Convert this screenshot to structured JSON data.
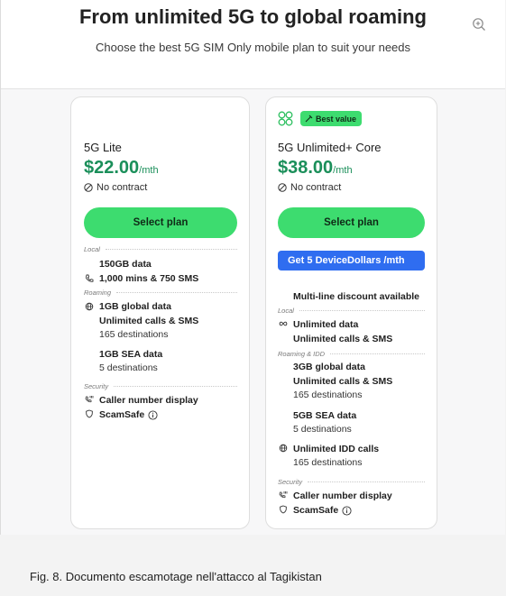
{
  "header": {
    "title": "From unlimited 5G to global roaming",
    "subtitle": "Choose the best 5G SIM Only mobile plan to suit your needs"
  },
  "colors": {
    "accent_green": "#3ddc6f",
    "price_green": "#1b8f5a",
    "promo_blue": "#2f6df0"
  },
  "icons": [
    "zoom-in-icon",
    "no-contract-icon",
    "phone-icon",
    "globe-icon",
    "caller-id-icon",
    "shield-icon",
    "info-icon",
    "infinity-icon",
    "5g-logo-icon",
    "sparkle-icon"
  ],
  "plans": [
    {
      "name": "5G Lite",
      "price": "$22.00",
      "period": "/mth",
      "contract": "No contract",
      "cta": "Select plan",
      "sections": [
        {
          "label": "Local",
          "items": [
            "150GB data",
            "1,000 mins & 750 SMS"
          ]
        },
        {
          "label": "Roaming",
          "items": [
            "1GB global data",
            "Unlimited calls & SMS",
            "165 destinations",
            "1GB SEA data",
            "5 destinations"
          ]
        },
        {
          "label": "Security",
          "items": [
            "Caller number display",
            "ScamSafe"
          ]
        }
      ]
    },
    {
      "name": "5G Unlimited+ Core",
      "badge": "Best value",
      "price": "$38.00",
      "period": "/mth",
      "contract": "No contract",
      "cta": "Select plan",
      "promo": "Get 5 DeviceDollars /mth",
      "extra": "Multi-line discount available",
      "sections": [
        {
          "label": "Local",
          "items": [
            "Unlimited data",
            "Unlimited calls & SMS"
          ]
        },
        {
          "label": "Roaming & IDD",
          "items": [
            "3GB global data",
            "Unlimited calls & SMS",
            "165 destinations",
            "5GB SEA data",
            "5 destinations",
            "Unlimited IDD calls",
            "165 destinations"
          ]
        },
        {
          "label": "Security",
          "items": [
            "Caller number display",
            "ScamSafe"
          ]
        }
      ]
    }
  ],
  "caption": "Fig. 8. Documento escamotage nell'attacco al Tagikistan"
}
